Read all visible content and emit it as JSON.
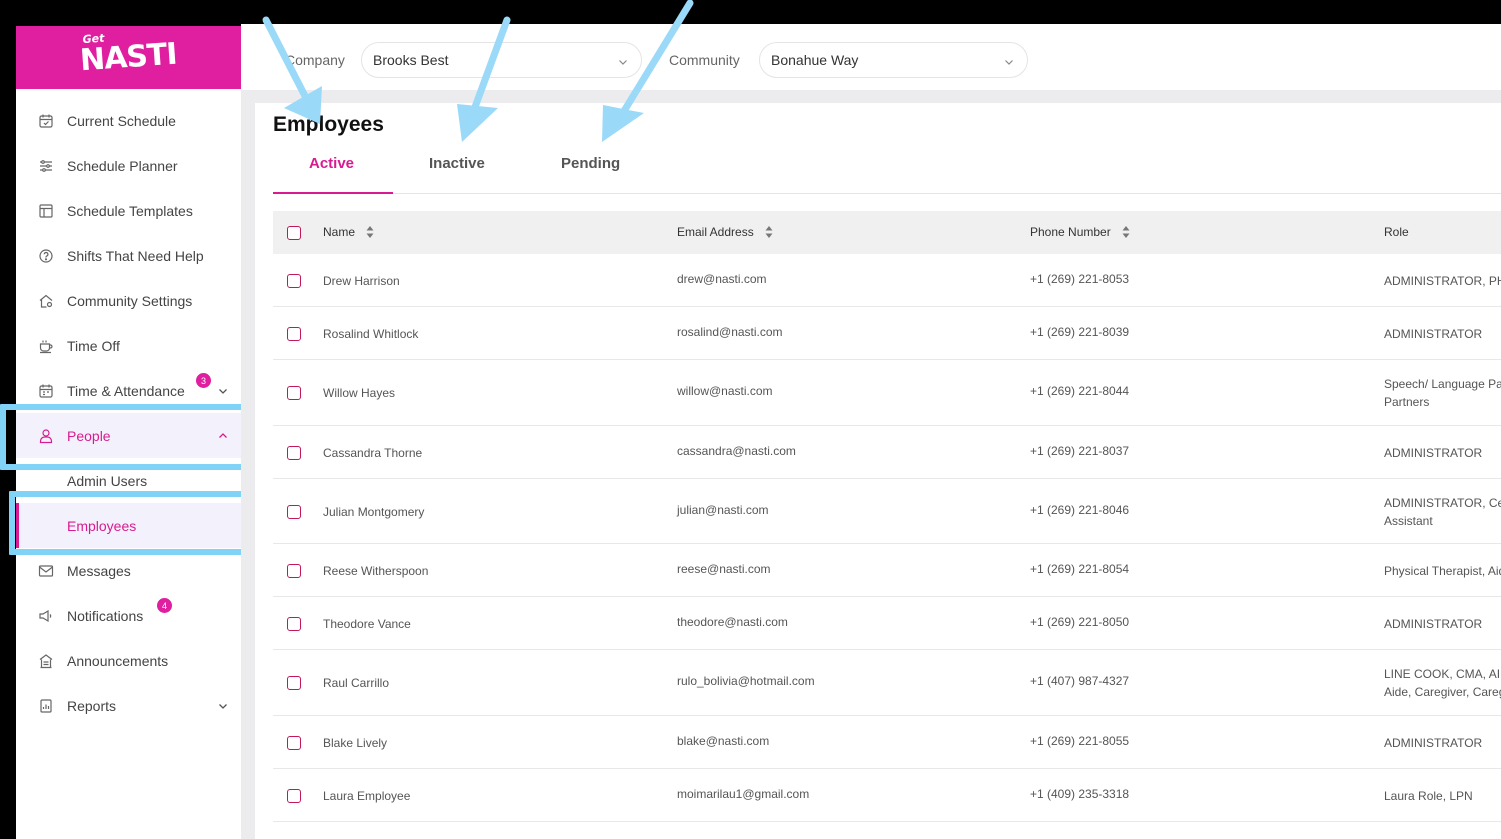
{
  "brand": {
    "logo_text": "NASTI",
    "logo_prefix": "Get"
  },
  "sidebar": {
    "items": [
      {
        "label": "Current Schedule",
        "icon": "calendar-icon"
      },
      {
        "label": "Schedule Planner",
        "icon": "sliders-icon"
      },
      {
        "label": "Schedule Templates",
        "icon": "template-icon"
      },
      {
        "label": "Shifts That Need Help",
        "icon": "help-circle-icon"
      },
      {
        "label": "Community Settings",
        "icon": "home-settings-icon"
      },
      {
        "label": "Time Off",
        "icon": "coffee-icon"
      },
      {
        "label": "Time & Attendance",
        "icon": "calendar-clock-icon",
        "badge": "3"
      },
      {
        "label": "People",
        "icon": "user-icon"
      },
      {
        "label": "Admin Users"
      },
      {
        "label": "Employees"
      },
      {
        "label": "Messages",
        "icon": "mail-icon"
      },
      {
        "label": "Notifications",
        "icon": "megaphone-icon",
        "badge": "4"
      },
      {
        "label": "Announcements",
        "icon": "announcement-icon"
      },
      {
        "label": "Reports",
        "icon": "report-icon"
      }
    ]
  },
  "filters": {
    "company_label": "Company",
    "company_value": "Brooks Best",
    "community_label": "Community",
    "community_value": "Bonahue Way"
  },
  "page": {
    "title": "Employees",
    "tabs": [
      "Active",
      "Inactive",
      "Pending"
    ],
    "active_tab": "Active"
  },
  "table": {
    "columns": [
      "Name",
      "Email Address",
      "Phone Number",
      "Role"
    ],
    "rows": [
      {
        "name": "Drew Harrison",
        "email": "drew@nasti.com",
        "phone": "+1 (269) 221-8053",
        "role": [
          "ADMINISTRATOR, PHYSICAL THERAPIST"
        ]
      },
      {
        "name": "Rosalind Whitlock",
        "email": "rosalind@nasti.com",
        "phone": "+1 (269) 221-8039",
        "role": [
          "ADMINISTRATOR"
        ]
      },
      {
        "name": "Willow Hayes",
        "email": "willow@nasti.com",
        "phone": "+1 (269) 221-8044",
        "role": [
          "Speech/ Language Pathologist",
          "Partners"
        ]
      },
      {
        "name": "Cassandra Thorne",
        "email": "cassandra@nasti.com",
        "phone": "+1 (269) 221-8037",
        "role": [
          "ADMINISTRATOR"
        ]
      },
      {
        "name": "Julian Montgomery",
        "email": "julian@nasti.com",
        "phone": "+1 (269) 221-8046",
        "role": [
          "ADMINISTRATOR, Certified",
          "Assistant"
        ]
      },
      {
        "name": "Reese Witherspoon",
        "email": "reese@nasti.com",
        "phone": "+1 (269) 221-8054",
        "role": [
          "Physical Therapist, Aide"
        ]
      },
      {
        "name": "Theodore Vance",
        "email": "theodore@nasti.com",
        "phone": "+1 (269) 221-8050",
        "role": [
          "ADMINISTRATOR"
        ]
      },
      {
        "name": "Raul Carrillo",
        "email": "rulo_bolivia@hotmail.com",
        "phone": "+1 (407) 987-4327",
        "role": [
          "LINE COOK, CMA, AIDE,",
          "Aide, Caregiver, Caregiver"
        ]
      },
      {
        "name": "Blake Lively",
        "email": "blake@nasti.com",
        "phone": "+1 (269) 221-8055",
        "role": [
          "ADMINISTRATOR"
        ]
      },
      {
        "name": "Laura Employee",
        "email": "moimarilau1@gmail.com",
        "phone": "+1 (409) 235-3318",
        "role": [
          "Laura Role, LPN"
        ]
      }
    ]
  },
  "colors": {
    "brand": "#e01fa0",
    "accent": "#d81b91",
    "highlight": "#80d2f6"
  }
}
